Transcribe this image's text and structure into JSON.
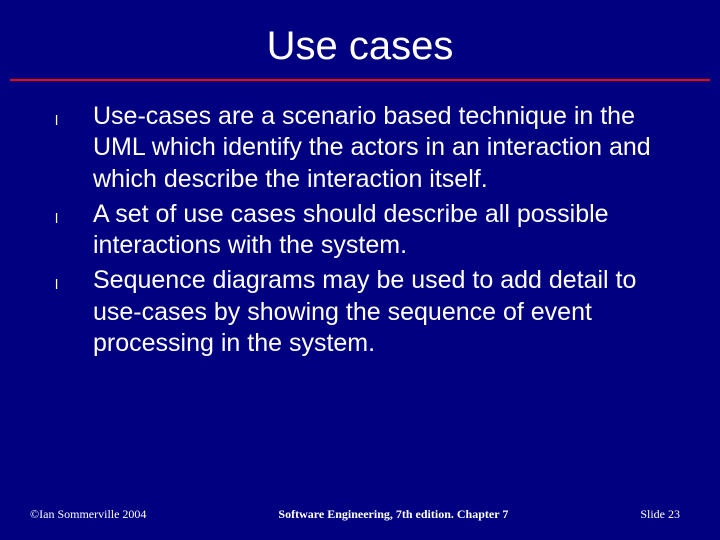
{
  "title": "Use cases",
  "bullets": [
    "Use-cases are a scenario based technique in the UML which identify the actors in an interaction and which describe the interaction itself.",
    "A set of use cases should describe all possible interactions with the system.",
    "Sequence diagrams may be used to add detail to use-cases by showing the sequence of event processing in the system."
  ],
  "bullet_glyph": "l",
  "footer": {
    "left": "©Ian Sommerville 2004",
    "center": "Software Engineering, 7th edition. Chapter 7",
    "right": "Slide 23"
  }
}
